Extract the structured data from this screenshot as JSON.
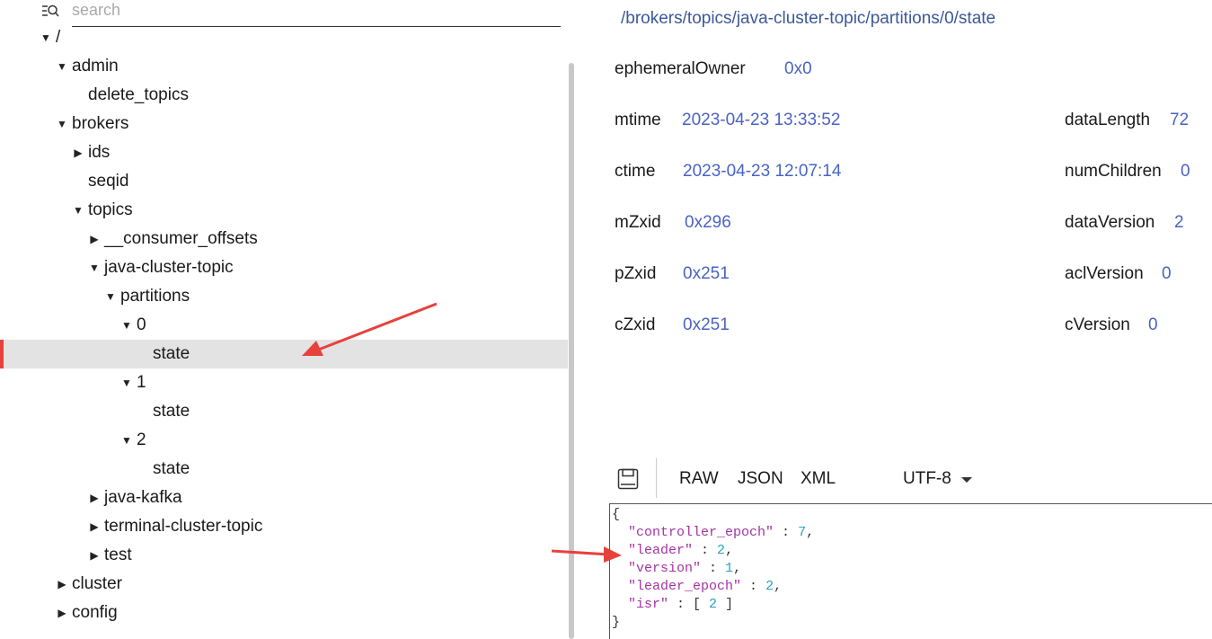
{
  "search": {
    "placeholder": "search",
    "value": ""
  },
  "tree": [
    {
      "id": "root",
      "label": "/",
      "depth": 0,
      "expanded": true
    },
    {
      "id": "admin",
      "label": "admin",
      "depth": 1,
      "expanded": true
    },
    {
      "id": "delete_topics",
      "label": "delete_topics",
      "depth": 2,
      "leaf": true
    },
    {
      "id": "brokers",
      "label": "brokers",
      "depth": 1,
      "expanded": true
    },
    {
      "id": "ids",
      "label": "ids",
      "depth": 2,
      "expanded": false
    },
    {
      "id": "seqid",
      "label": "seqid",
      "depth": 2,
      "leaf": true
    },
    {
      "id": "topics",
      "label": "topics",
      "depth": 2,
      "expanded": true
    },
    {
      "id": "consumer_offsets",
      "label": "__consumer_offsets",
      "depth": 3,
      "expanded": false
    },
    {
      "id": "java_cluster_topic",
      "label": "java-cluster-topic",
      "depth": 3,
      "expanded": true
    },
    {
      "id": "partitions",
      "label": "partitions",
      "depth": 4,
      "expanded": true
    },
    {
      "id": "p0",
      "label": "0",
      "depth": 5,
      "expanded": true
    },
    {
      "id": "p0_state",
      "label": "state",
      "depth": 6,
      "leaf": true,
      "selected": true
    },
    {
      "id": "p1",
      "label": "1",
      "depth": 5,
      "expanded": true
    },
    {
      "id": "p1_state",
      "label": "state",
      "depth": 6,
      "leaf": true
    },
    {
      "id": "p2",
      "label": "2",
      "depth": 5,
      "expanded": true
    },
    {
      "id": "p2_state",
      "label": "state",
      "depth": 6,
      "leaf": true
    },
    {
      "id": "java_kafka",
      "label": "java-kafka",
      "depth": 3,
      "expanded": false
    },
    {
      "id": "terminal_cluster_topic",
      "label": "terminal-cluster-topic",
      "depth": 3,
      "expanded": false
    },
    {
      "id": "test",
      "label": "test",
      "depth": 3,
      "expanded": false
    },
    {
      "id": "cluster",
      "label": "cluster",
      "depth": 1,
      "expanded": false
    },
    {
      "id": "config",
      "label": "config",
      "depth": 1,
      "expanded": false
    }
  ],
  "node": {
    "path": "/brokers/topics/java-cluster-topic/partitions/0/state",
    "stats": {
      "ephemeralOwner": {
        "key": "ephemeralOwner",
        "value": "0x0"
      },
      "mtime": {
        "key": "mtime",
        "value": "2023-04-23 13:33:52"
      },
      "ctime": {
        "key": "ctime",
        "value": "2023-04-23 12:07:14"
      },
      "mZxid": {
        "key": "mZxid",
        "value": "0x296"
      },
      "pZxid": {
        "key": "pZxid",
        "value": "0x251"
      },
      "cZxid": {
        "key": "cZxid",
        "value": "0x251"
      },
      "dataLength": {
        "key": "dataLength",
        "value": "72"
      },
      "numChildren": {
        "key": "numChildren",
        "value": "0"
      },
      "dataVersion": {
        "key": "dataVersion",
        "value": "2"
      },
      "aclVersion": {
        "key": "aclVersion",
        "value": "0"
      },
      "cVersion": {
        "key": "cVersion",
        "value": "0"
      }
    }
  },
  "toolbar": {
    "raw": "RAW",
    "json": "JSON",
    "xml": "XML",
    "encoding": "UTF-8"
  },
  "content": {
    "open": "{",
    "close": "}",
    "entries": [
      {
        "key": "\"controller_epoch\"",
        "value": "7"
      },
      {
        "key": "\"leader\"",
        "value": "2"
      },
      {
        "key": "\"version\"",
        "value": "1"
      },
      {
        "key": "\"leader_epoch\"",
        "value": "2"
      },
      {
        "key": "\"isr\"",
        "value": "2",
        "array": true
      }
    ]
  },
  "colors": {
    "accent": "#e8413c",
    "selected_bg": "#e3e3e3",
    "value_blue": "#4a63c4",
    "json_key": "#a335a3",
    "json_number": "#2aa1c0"
  }
}
